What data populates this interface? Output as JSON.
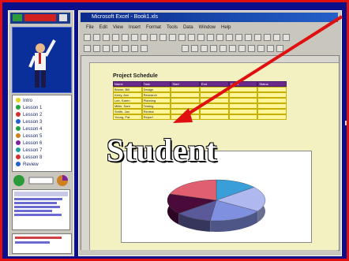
{
  "overlay": {
    "label": "Student"
  },
  "window": {
    "title": "Microsoft Excel - Book1.xls"
  },
  "menu": [
    "File",
    "Edit",
    "View",
    "Insert",
    "Format",
    "Tools",
    "Data",
    "Window",
    "Help"
  ],
  "sheet": {
    "title": "Project Schedule",
    "headers": [
      "Name",
      "Task",
      "Start",
      "End",
      "Hours",
      "Status"
    ],
    "rows": [
      [
        "Brown, Bill",
        "Design",
        "",
        "",
        "",
        ""
      ],
      [
        "Kerry, Ann",
        "Research",
        "",
        "",
        "",
        ""
      ],
      [
        "Lee, Karen",
        "Planning",
        "",
        "",
        "",
        ""
      ],
      [
        "Miller, Sam",
        "Testing",
        "",
        "",
        "",
        ""
      ],
      [
        "Smith, Jan",
        "Review",
        "",
        "",
        "",
        ""
      ],
      [
        "Young, Pat",
        "Report",
        "",
        "",
        "",
        ""
      ]
    ]
  },
  "chart": {
    "type": "pie",
    "slices": [
      {
        "value": 14,
        "color": "#3a9fd8"
      },
      {
        "value": 20,
        "color": "#b0b8f0"
      },
      {
        "value": 18,
        "color": "#8090e0"
      },
      {
        "value": 12,
        "color": "#5a5a9a"
      },
      {
        "value": 16,
        "color": "#4a0a3a"
      },
      {
        "value": 20,
        "color": "#e06070"
      }
    ]
  },
  "left_panel": {
    "top_chips": [
      "■■",
      "►"
    ],
    "nav_items": [
      "Intro",
      "Lesson 1",
      "Lesson 2",
      "Lesson 3",
      "Lesson 4",
      "Lesson 5",
      "Lesson 6",
      "Lesson 7",
      "Lesson 8",
      "Review"
    ],
    "nav_colors": [
      "#e0d020",
      "#20a040",
      "#d03030",
      "#2060d0",
      "#20a040",
      "#d08020",
      "#8020a0",
      "#20a0a0",
      "#d03030",
      "#2060d0"
    ]
  },
  "colors": {
    "accent": "#e01010",
    "background": "#0b0f8a"
  }
}
